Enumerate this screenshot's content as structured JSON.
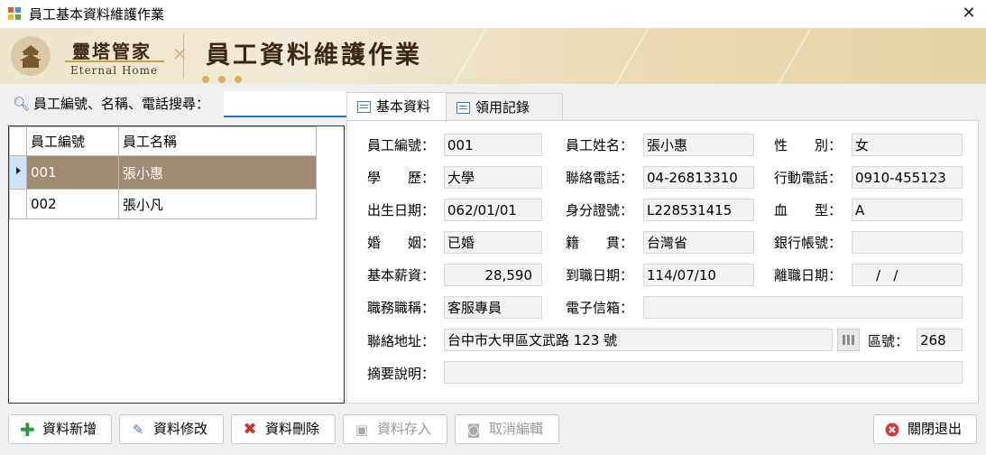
{
  "window": {
    "title": "員工基本資料維護作業",
    "close_glyph": "✕"
  },
  "banner": {
    "brand_cn": "靈塔管家",
    "brand_en": "Eternal Home",
    "heading": "員工資料維護作業"
  },
  "search": {
    "label": "員工編號、名稱、電話搜尋：",
    "value": ""
  },
  "grid": {
    "columns": [
      "員工編號",
      "員工名稱"
    ],
    "rows": [
      {
        "id": "001",
        "name": "張小惠",
        "selected": true
      },
      {
        "id": "002",
        "name": "張小凡",
        "selected": false
      }
    ]
  },
  "tabs": [
    {
      "label": "基本資料",
      "active": true
    },
    {
      "label": "領用記錄",
      "active": false
    }
  ],
  "form": {
    "emp_no": {
      "label": "員工編號：",
      "value": "001"
    },
    "emp_name": {
      "label": "員工姓名：",
      "value": "張小惠"
    },
    "gender": {
      "label": "性　　別：",
      "value": "女"
    },
    "education": {
      "label": "學　　歷：",
      "value": "大學"
    },
    "phone": {
      "label": "聯絡電話：",
      "value": "04-26813310"
    },
    "mobile": {
      "label": "行動電話：",
      "value": "0910-455123"
    },
    "birthday": {
      "label": "出生日期：",
      "value": "062/01/01"
    },
    "id_no": {
      "label": "身分證號：",
      "value": "L228531415"
    },
    "blood": {
      "label": "血　　型：",
      "value": "A"
    },
    "marriage": {
      "label": "婚　　姻：",
      "value": "已婚"
    },
    "native": {
      "label": "籍　　貫：",
      "value": "台灣省"
    },
    "bank": {
      "label": "銀行帳號：",
      "value": ""
    },
    "salary": {
      "label": "基本薪資：",
      "value": "28,590"
    },
    "hire_date": {
      "label": "到職日期：",
      "value": "114/07/10"
    },
    "leave_date": {
      "label": "離職日期：",
      "value": "/   /"
    },
    "title": {
      "label": "職務職稱：",
      "value": "客服專員"
    },
    "email": {
      "label": "電子信箱：",
      "value": ""
    },
    "address": {
      "label": "聯絡地址：",
      "value": "台中市大甲區文武路 123 號"
    },
    "zip": {
      "label": "區號：",
      "value": "268"
    },
    "memo": {
      "label": "摘要說明：",
      "value": ""
    }
  },
  "buttons": {
    "add": "資料新增",
    "edit": "資料修改",
    "delete": "資料刪除",
    "save": "資料存入",
    "cancel": "取消編輯",
    "exit": "關閉退出"
  }
}
